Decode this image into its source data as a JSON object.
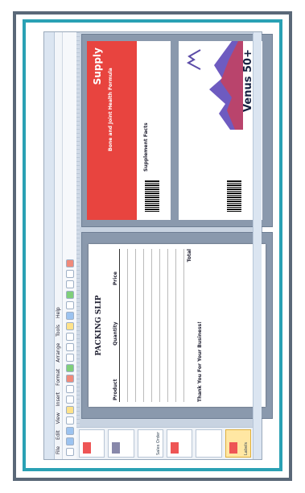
{
  "app": {
    "title": "",
    "menu": [
      "File",
      "Edit",
      "View",
      "Insert",
      "Format",
      "Arrange",
      "Tools",
      "Help"
    ]
  },
  "thumbnails": [
    {
      "label": ""
    },
    {
      "label": ""
    },
    {
      "label": "Sales Order"
    },
    {
      "label": ""
    },
    {
      "label": ""
    },
    {
      "label": "Labels"
    },
    {
      "label": ""
    }
  ],
  "packing_slip": {
    "title": "PACKING SLIP",
    "columns": [
      "Product",
      "Quantity",
      "Price"
    ],
    "rows": [
      [
        "",
        "",
        ""
      ],
      [
        "",
        "",
        ""
      ],
      [
        "",
        "",
        ""
      ],
      [
        "",
        "",
        ""
      ],
      [
        "",
        "",
        ""
      ],
      [
        "",
        "",
        ""
      ],
      [
        "",
        "",
        ""
      ],
      [
        "",
        "",
        ""
      ]
    ],
    "total_label": "Total",
    "thanks": "Thank You For Your Business!"
  },
  "label_red": {
    "brand": "Supply",
    "subtitle": "Bone and Joint Health Formula",
    "supplement": "Supplement Facts"
  },
  "label_venus": {
    "title": "Venus 50+"
  },
  "colors": {
    "frame_outer": "#5a6878",
    "frame_inner": "#2aa1b4",
    "label_red": "#e8443f"
  }
}
